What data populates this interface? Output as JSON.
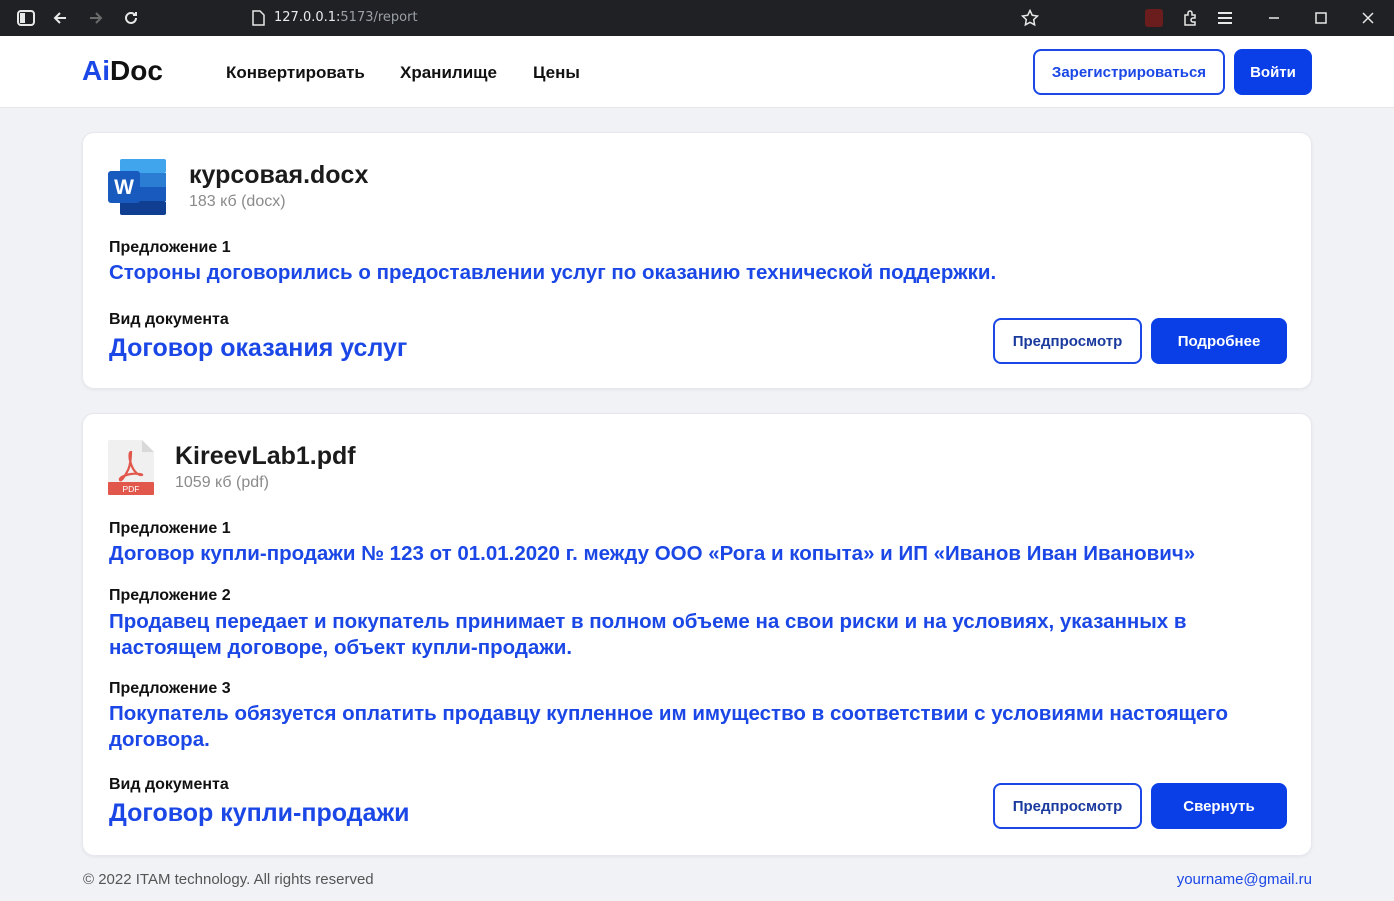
{
  "browser": {
    "url_host": "127.0.0.1:",
    "url_path": "5173/report"
  },
  "header": {
    "logo_accent": "Ai",
    "logo_rest": "Doc",
    "nav": [
      "Конвертировать",
      "Хранилище",
      "Цены"
    ],
    "register_label": "Зарегистрироваться",
    "login_label": "Войти"
  },
  "documents": [
    {
      "icon": "word-file-icon",
      "file_name": "курсовая.docx",
      "file_size": "183 кб (docx)",
      "sentences": [
        {
          "label": "Предложение 1",
          "text": "Стороны договорились о предоставлении услуг по оказанию технической поддержки."
        }
      ],
      "doc_type_label": "Вид документа",
      "doc_type": "Договор оказания услуг",
      "preview_label": "Предпросмотр",
      "action_label": "Подробнее"
    },
    {
      "icon": "pdf-file-icon",
      "icon_caption": "PDF",
      "file_name": "KireevLab1.pdf",
      "file_size": "1059 кб (pdf)",
      "sentences": [
        {
          "label": "Предложение 1",
          "text": "Договор купли-продажи № 123 от 01.01.2020 г. между ООО «Рога и копыта» и ИП «Иванов Иван Иванович»"
        },
        {
          "label": "Предложение 2",
          "text": "Продавец передает и покупатель принимает в полном объеме на свои риски и на условиях, указанных в настоящем договоре, объект купли-продажи."
        },
        {
          "label": "Предложение 3",
          "text": "Покупатель обязуется оплатить продавцу купленное им имущество в соответствии с условиями настоящего договора."
        }
      ],
      "doc_type_label": "Вид документа",
      "doc_type": "Договор купли-продажи",
      "preview_label": "Предпросмотр",
      "action_label": "Свернуть"
    }
  ],
  "footer": {
    "copyright": "© 2022 ITAM technology. All rights reserved",
    "email": "yourname@gmail.ru"
  },
  "colors": {
    "accent": "#1a47e6",
    "button": "#0a3fe8",
    "background": "#f1f2f6"
  }
}
